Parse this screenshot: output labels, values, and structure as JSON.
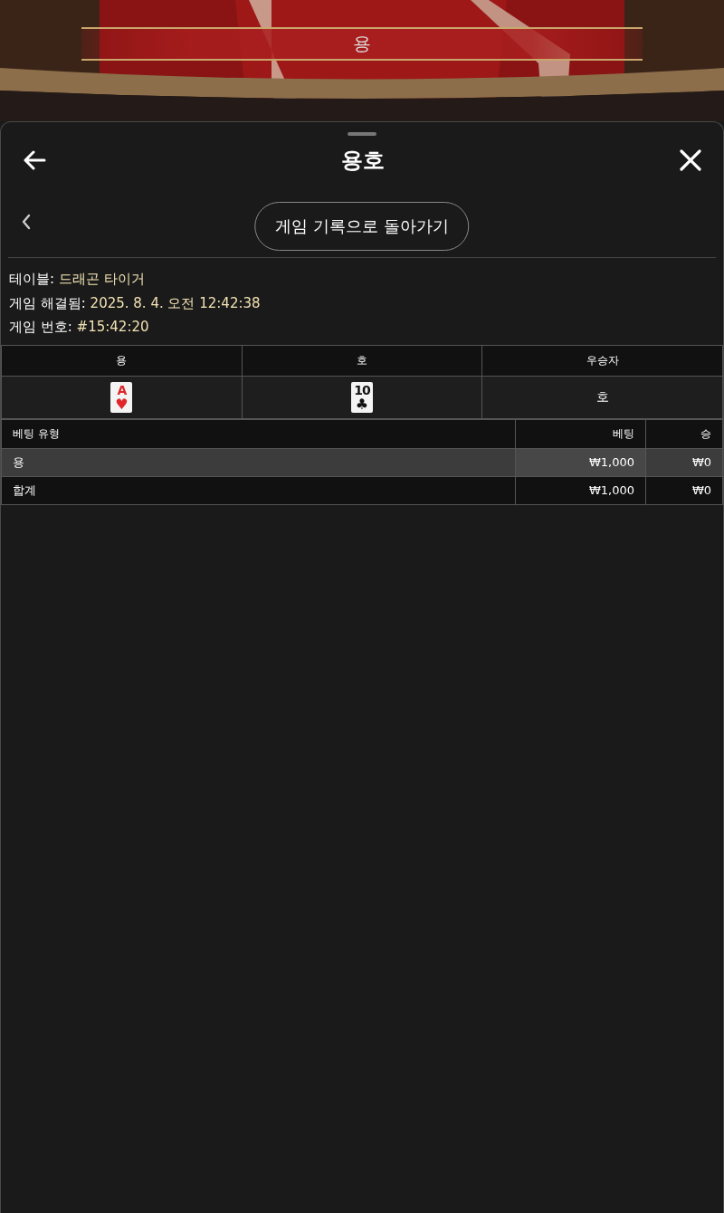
{
  "video": {
    "result_banner": "용"
  },
  "header": {
    "title": "용호"
  },
  "back_button": {
    "label": "게임 기록으로 돌아가기"
  },
  "details": [
    {
      "label": "테이블:",
      "value": "드래곤 타이거"
    },
    {
      "label": "게임 해결됨:",
      "value": "2025. 8. 4. 오전 12:42:38"
    },
    {
      "label": "게임 번호:",
      "value": "#15:42:20"
    }
  ],
  "result_table": {
    "columns": [
      "용",
      "호",
      "우승자"
    ],
    "cards": [
      {
        "rank": "A",
        "suit": "♥",
        "color": "#e0262a"
      },
      {
        "rank": "10",
        "suit": "♣",
        "color": "#111111"
      }
    ],
    "winner": "호"
  },
  "bet_table": {
    "columns": [
      "베팅 유형",
      "베팅",
      "승"
    ],
    "rows": [
      {
        "kind": "bet",
        "selected": true,
        "cells": [
          "용",
          "₩1,000",
          "₩0"
        ]
      },
      {
        "kind": "total",
        "selected": false,
        "cells": [
          "합계",
          "₩1,000",
          "₩0"
        ]
      }
    ]
  }
}
